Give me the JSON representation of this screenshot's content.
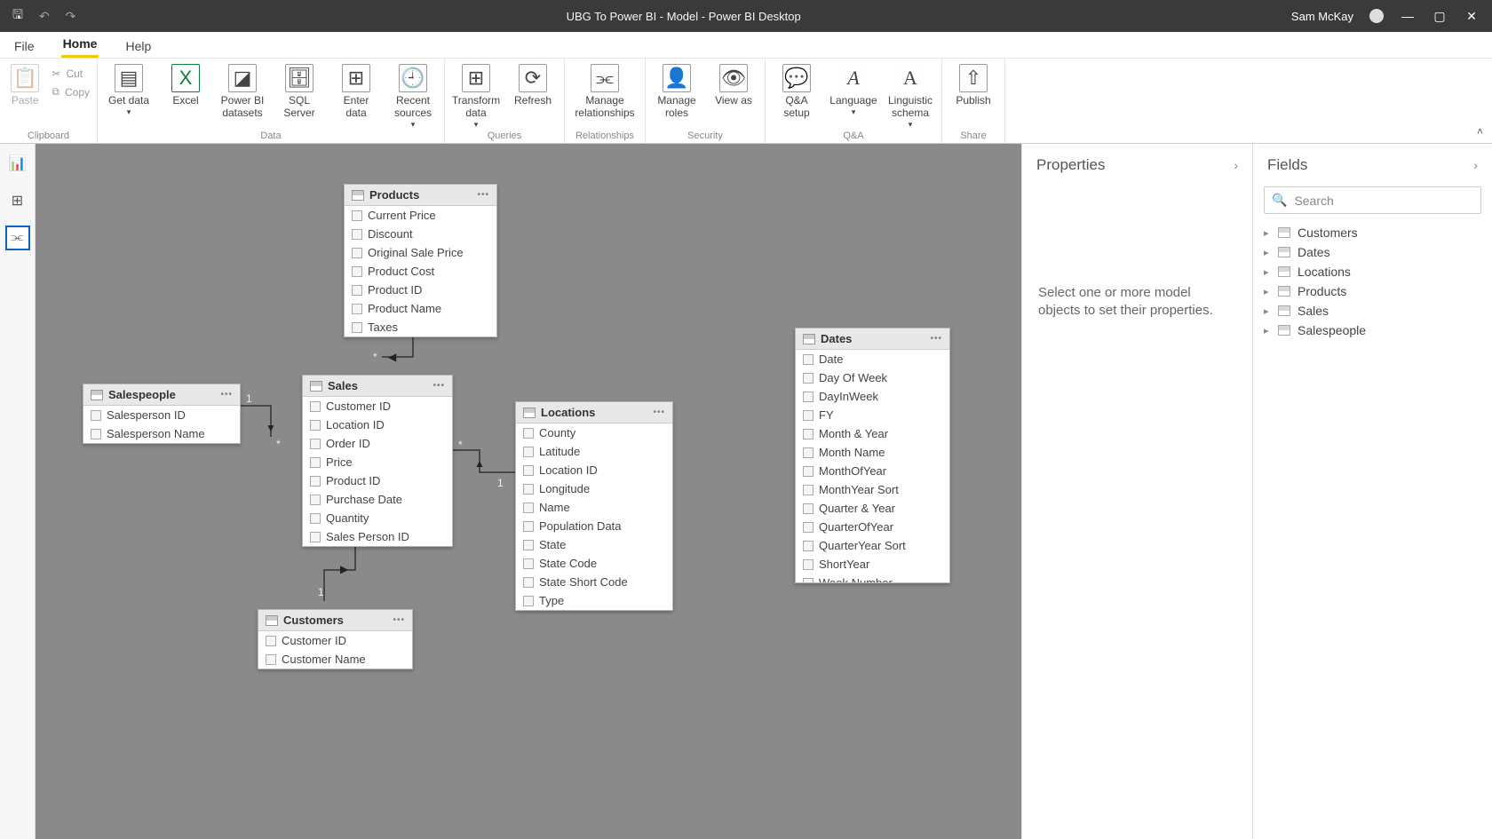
{
  "titleBar": {
    "title": "UBG To Power BI - Model - Power BI Desktop",
    "user": "Sam McKay"
  },
  "menuTabs": {
    "file": "File",
    "home": "Home",
    "help": "Help"
  },
  "ribbon": {
    "clipboard": {
      "paste": "Paste",
      "cut": "Cut",
      "copy": "Copy",
      "label": "Clipboard"
    },
    "data": {
      "getData": "Get data",
      "excel": "Excel",
      "pbi": "Power BI datasets",
      "sql": "SQL Server",
      "enter": "Enter data",
      "recent": "Recent sources",
      "label": "Data"
    },
    "queries": {
      "transform": "Transform data",
      "refresh": "Refresh",
      "label": "Queries"
    },
    "relationships": {
      "manage": "Manage relationships",
      "label": "Relationships"
    },
    "security": {
      "roles": "Manage roles",
      "viewAs": "View as",
      "label": "Security"
    },
    "qa": {
      "setup": "Q&A setup",
      "language": "Language",
      "schema": "Linguistic schema",
      "label": "Q&A"
    },
    "share": {
      "publish": "Publish",
      "label": "Share"
    }
  },
  "properties": {
    "title": "Properties",
    "hint": "Select one or more model objects to set their properties."
  },
  "fieldsPanel": {
    "title": "Fields",
    "searchPlaceholder": "Search",
    "tables": [
      "Customers",
      "Dates",
      "Locations",
      "Products",
      "Sales",
      "Salespeople"
    ]
  },
  "tables": {
    "products": {
      "name": "Products",
      "cols": [
        "Current Price",
        "Discount",
        "Original Sale Price",
        "Product Cost",
        "Product ID",
        "Product Name",
        "Taxes"
      ]
    },
    "salespeople": {
      "name": "Salespeople",
      "cols": [
        "Salesperson ID",
        "Salesperson Name"
      ]
    },
    "sales": {
      "name": "Sales",
      "cols": [
        "Customer ID",
        "Location ID",
        "Order ID",
        "Price",
        "Product ID",
        "Purchase Date",
        "Quantity",
        "Sales Person ID"
      ]
    },
    "locations": {
      "name": "Locations",
      "cols": [
        "County",
        "Latitude",
        "Location ID",
        "Longitude",
        "Name",
        "Population Data",
        "State",
        "State Code",
        "State Short Code",
        "Type"
      ]
    },
    "dates": {
      "name": "Dates",
      "cols": [
        "Date",
        "Day Of Week",
        "DayInWeek",
        "FY",
        "Month & Year",
        "Month Name",
        "MonthOfYear",
        "MonthYear Sort",
        "Quarter & Year",
        "QuarterOfYear",
        "QuarterYear Sort",
        "ShortYear",
        "Week Number"
      ]
    },
    "customers": {
      "name": "Customers",
      "cols": [
        "Customer ID",
        "Customer Name"
      ]
    }
  },
  "relMarkers": {
    "one": "1",
    "many": "*"
  }
}
